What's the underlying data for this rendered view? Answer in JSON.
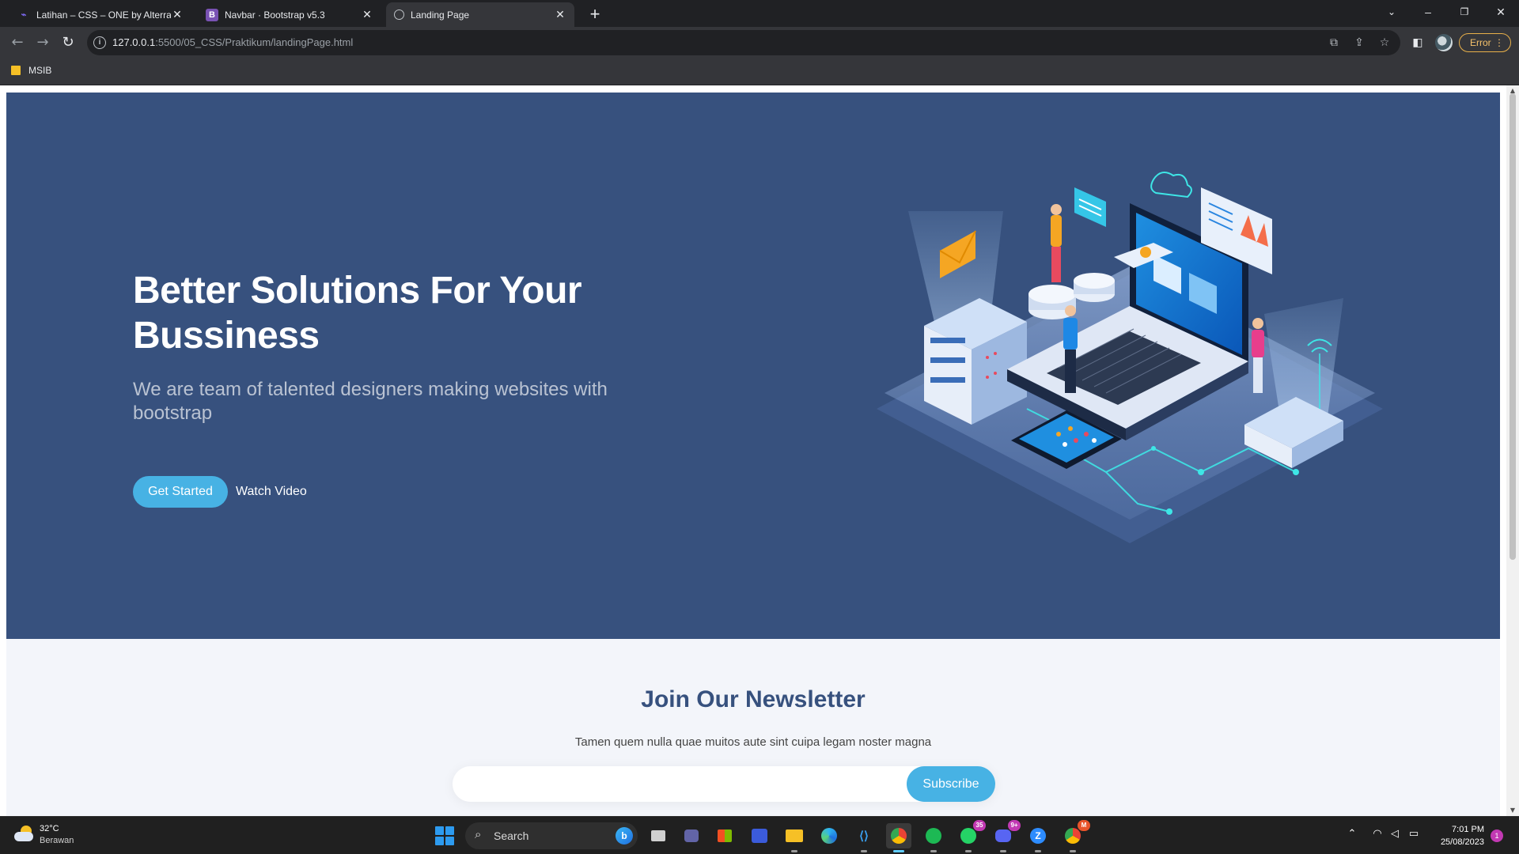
{
  "browser": {
    "tabs": [
      {
        "title": "Latihan – CSS – ONE by Alterra Academy",
        "favicon": "alterra-icon",
        "active": false
      },
      {
        "title": "Navbar · Bootstrap v5.3",
        "favicon": "bootstrap-icon",
        "active": false
      },
      {
        "title": "Landing Page",
        "favicon": "globe-icon",
        "active": true
      }
    ],
    "url_host": "127.0.0.1",
    "url_path": ":5500/05_CSS/Praktikum/landingPage.html",
    "error_label": "Error",
    "bookmarks": [
      {
        "label": "MSIB",
        "icon": "folder-icon"
      }
    ]
  },
  "hero": {
    "title": "Better Solutions For Your Bussiness",
    "subtitle": "We are team of talented designers making websites with bootstrap",
    "cta_primary": "Get Started",
    "cta_secondary": "Watch Video",
    "colors": {
      "background": "#37517e",
      "accent": "#47b2e4"
    }
  },
  "newsletter": {
    "title": "Join Our Newsletter",
    "subtitle": "Tamen quem nulla quae muitos aute sint cuipa legam noster magna",
    "input_value": "",
    "button_label": "Subscribe"
  },
  "taskbar": {
    "weather_temp": "32°C",
    "weather_desc": "Berawan",
    "search_label": "Search",
    "time": "7:01 PM",
    "date": "25/08/2023",
    "notification_count": "1",
    "badges": {
      "whatsapp": "35",
      "discord": "9+",
      "chrome_profile": "M"
    }
  }
}
